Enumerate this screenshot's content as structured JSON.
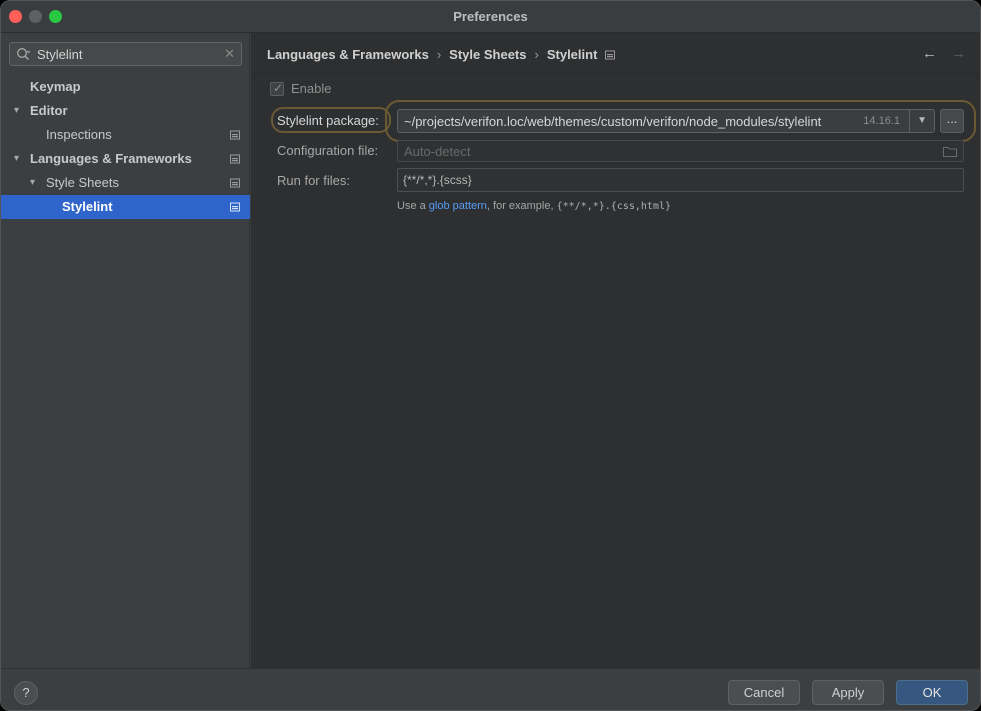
{
  "window": {
    "title": "Preferences"
  },
  "sidebar": {
    "search": {
      "value": "Stylelint",
      "icon": "search-icon"
    },
    "items": [
      {
        "label": "Keymap",
        "level": 0,
        "expandable": false,
        "bold": true,
        "selected": false
      },
      {
        "label": "Editor",
        "level": 0,
        "expandable": true,
        "bold": true,
        "selected": false
      },
      {
        "label": "Inspections",
        "level": 1,
        "expandable": false,
        "bold": false,
        "selected": false,
        "project_icon": true
      },
      {
        "label": "Languages & Frameworks",
        "level": 0,
        "expandable": true,
        "bold": true,
        "selected": false,
        "project_icon": true
      },
      {
        "label": "Style Sheets",
        "level": 1,
        "expandable": true,
        "bold": false,
        "selected": false,
        "project_icon": true
      },
      {
        "label": "Stylelint",
        "level": 2,
        "expandable": false,
        "bold": true,
        "selected": true,
        "project_icon": true
      }
    ]
  },
  "content": {
    "breadcrumb": [
      "Languages & Frameworks",
      "Style Sheets",
      "Stylelint"
    ],
    "nav": {
      "back": "←",
      "forward": "→"
    },
    "enable": {
      "label": "Enable",
      "checked": true
    },
    "package": {
      "label": "Stylelint package:",
      "path": "~/projects/verifon.loc/web/themes/custom/verifon/node_modules/stylelint",
      "version": "14.16.1",
      "browse": "..."
    },
    "config": {
      "label": "Configuration file:",
      "placeholder": "Auto-detect"
    },
    "run_for_files": {
      "label": "Run for files:",
      "value": "{**/*,*}.{scss}"
    },
    "hint": {
      "prefix": "Use a ",
      "link": "glob pattern",
      "middle": ", for example, ",
      "example": "{**/*,*}.{css,html}"
    }
  },
  "footer": {
    "help": "?",
    "cancel": "Cancel",
    "apply": "Apply",
    "ok": "OK"
  },
  "colors": {
    "accent_selected": "#2f65ca",
    "ok_button": "#365880",
    "highlight_border": "#6b5a33",
    "link": "#589df6"
  }
}
